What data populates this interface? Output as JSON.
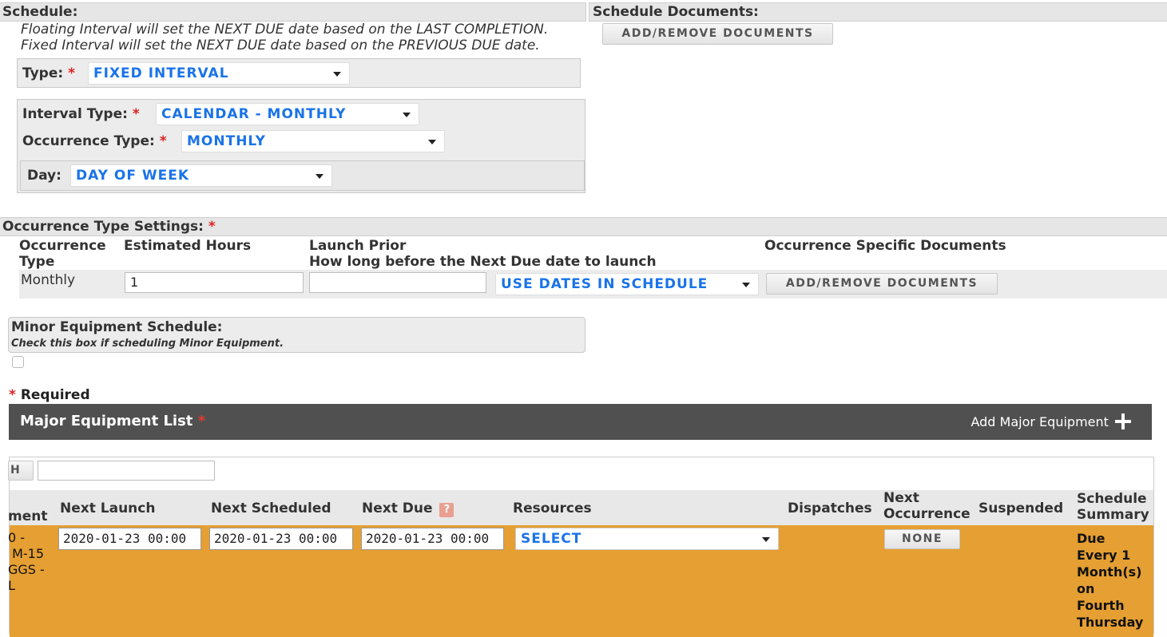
{
  "schedule": {
    "header": "Schedule:",
    "note_line1": "Floating Interval will set the NEXT DUE date based on the LAST COMPLETION.",
    "note_line2": "Fixed Interval will set the NEXT DUE date based on the PREVIOUS DUE date.",
    "type_label": "Type:",
    "type_value": "FIXED INTERVAL",
    "interval_type_label": "Interval Type:",
    "interval_type_value": "CALENDAR - MONTHLY",
    "occurrence_type_label": "Occurrence Type:",
    "occurrence_type_value": "MONTHLY",
    "day_label": "Day:",
    "day_value": "DAY OF WEEK",
    "required_mark": "*"
  },
  "schedule_documents": {
    "header": "Schedule Documents:",
    "button": "ADD/REMOVE DOCUMENTS"
  },
  "occurrence_settings": {
    "header": "Occurrence Type Settings:",
    "col_occurrence_type_1": "Occurrence",
    "col_occurrence_type_2": "Type",
    "col_estimated_hours": "Estimated Hours",
    "col_launch_prior_1": "Launch Prior",
    "col_launch_prior_2": "How long before the Next Due date to launch",
    "col_docs": "Occurrence Specific Documents",
    "row_type": "Monthly",
    "row_hours": "1",
    "row_launch_prior": "",
    "row_launch_select": "USE DATES IN SCHEDULE",
    "row_docs_button": "ADD/REMOVE DOCUMENTS"
  },
  "minor_equipment": {
    "header": "Minor Equipment Schedule:",
    "hint": "Check this box if scheduling Minor Equipment.",
    "checked": false
  },
  "required_note": "Required",
  "major_equipment": {
    "title": "Major Equipment List",
    "add_label": "Add Major Equipment",
    "search_button": "H",
    "search_value": "",
    "columns": {
      "equipment": "ment",
      "next_launch": "Next Launch",
      "next_scheduled": "Next Scheduled",
      "next_due": "Next Due",
      "resources": "Resources",
      "dispatches": "Dispatches",
      "next_occurrence_1": "Next",
      "next_occurrence_2": "Occurrence",
      "suspended": "Suspended",
      "schedule_summary_1": "Schedule",
      "schedule_summary_2": "Summary"
    },
    "row": {
      "equipment_1": "0 -",
      "equipment_2": " M-15",
      "equipment_3": "GGS -",
      "equipment_4": "L",
      "next_launch": "2020-01-23 00:00",
      "next_scheduled": "2020-01-23 00:00",
      "next_due": "2020-01-23 00:00",
      "resources": "SELECT",
      "next_occurrence": "NONE",
      "summary_1": "Due",
      "summary_2": "Every 1",
      "summary_3": "Month(s)",
      "summary_4": "on",
      "summary_5": "Fourth",
      "summary_6": "Thursday"
    },
    "row_color": "#e59f32",
    "header_color": "#505050"
  }
}
